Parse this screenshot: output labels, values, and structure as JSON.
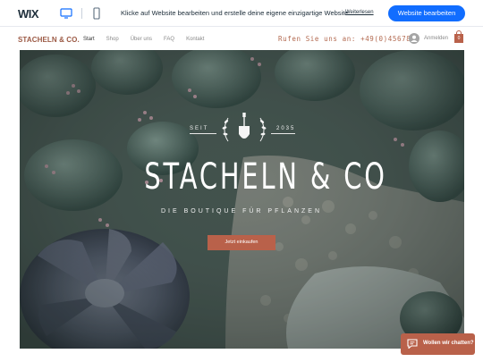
{
  "wix_bar": {
    "logo": "WIX",
    "promo": "Klicke auf Website bearbeiten und erstelle deine eigene einzigartige Website.",
    "learn_more": "Weiterlesen",
    "edit_button": "Website bearbeiten",
    "icons": [
      "desktop-icon",
      "mobile-icon"
    ],
    "accent": "#116dff"
  },
  "header": {
    "logo": "STACHELN & CO.",
    "nav": [
      {
        "label": "Start",
        "active": true
      },
      {
        "label": "Shop",
        "active": false
      },
      {
        "label": "Über uns",
        "active": false
      },
      {
        "label": "FAQ",
        "active": false
      },
      {
        "label": "Kontakt",
        "active": false
      }
    ],
    "phone": "Rufen Sie uns an: +49(0)4567890",
    "login": "Anmelden",
    "cart_count": "0",
    "brand_color": "#9c5a45"
  },
  "hero": {
    "since": "SEIT",
    "year": "2035",
    "title": "STACHELN & CO",
    "tagline": "DIE BOUTIQUE FÜR PFLANZEN",
    "button": "Jetzt einkaufen",
    "button_color": "#b9614a"
  },
  "chat": {
    "label": "Wollen wir chatten?",
    "icon": "chat-icon"
  }
}
